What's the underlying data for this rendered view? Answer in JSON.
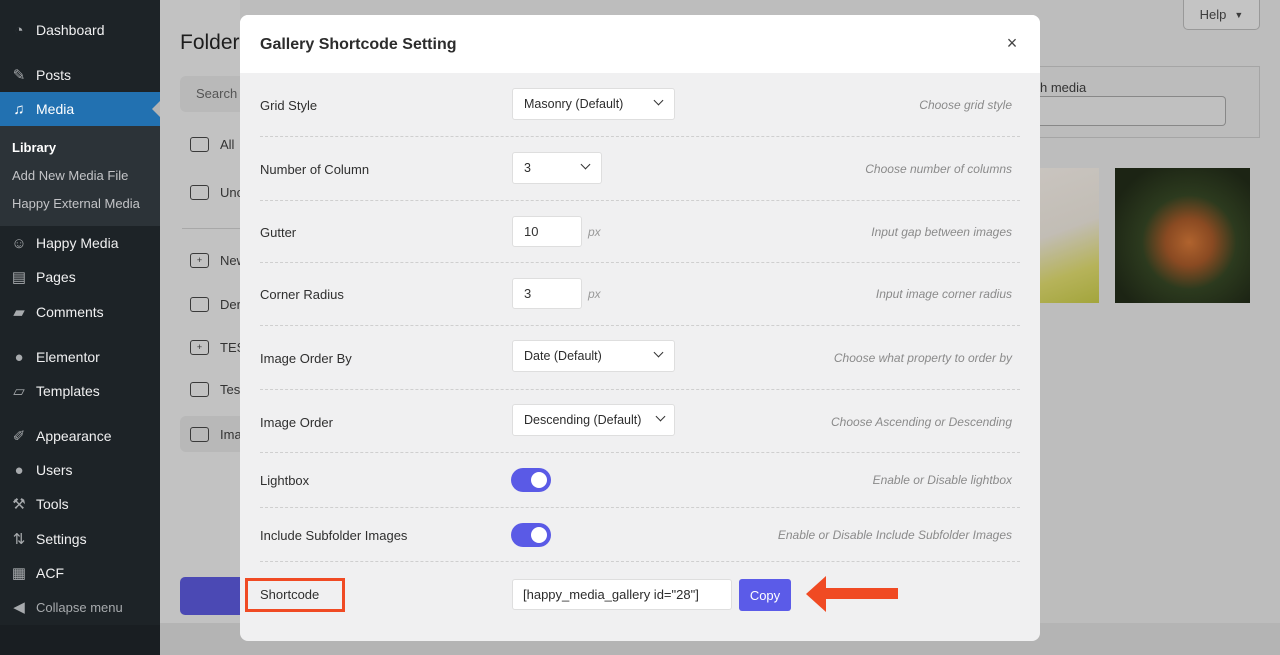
{
  "sidebar": {
    "items": [
      {
        "label": "Dashboard",
        "icon": "dashboard-icon"
      },
      {
        "label": "Posts",
        "icon": "pin-icon"
      },
      {
        "label": "Media",
        "icon": "media-icon",
        "active": true
      },
      {
        "label": "Happy Media",
        "icon": "happy-media-icon"
      },
      {
        "label": "Pages",
        "icon": "pages-icon"
      },
      {
        "label": "Comments",
        "icon": "comment-icon"
      },
      {
        "label": "Elementor",
        "icon": "elementor-icon"
      },
      {
        "label": "Templates",
        "icon": "folder-open-icon"
      },
      {
        "label": "Appearance",
        "icon": "brush-icon"
      },
      {
        "label": "Users",
        "icon": "user-icon"
      },
      {
        "label": "Tools",
        "icon": "wrench-icon"
      },
      {
        "label": "Settings",
        "icon": "sliders-icon"
      },
      {
        "label": "ACF",
        "icon": "table-icon"
      }
    ],
    "submenu": [
      {
        "label": "Library",
        "current": true
      },
      {
        "label": "Add New Media File"
      },
      {
        "label": "Happy External Media"
      }
    ],
    "collapse_label": "Collapse menu"
  },
  "background": {
    "folder_title": "Folder",
    "folder_search_placeholder": "Search",
    "folders": [
      "All",
      "Unc",
      "New",
      "Der",
      "TES",
      "Tes",
      "Ima"
    ],
    "help_label": "Help",
    "search_media_label": "h media"
  },
  "modal": {
    "title": "Gallery Shortcode Setting",
    "close_label": "×",
    "rows": [
      {
        "label": "Grid Style",
        "value": "Masonry (Default)",
        "desc": "Choose grid style"
      },
      {
        "label": "Number of Column",
        "value": "3",
        "desc": "Choose number of columns"
      },
      {
        "label": "Gutter",
        "value": "10",
        "unit": "px",
        "desc": "Input gap between images"
      },
      {
        "label": "Corner Radius",
        "value": "3",
        "unit": "px",
        "desc": "Input image corner radius"
      },
      {
        "label": "Image Order By",
        "value": "Date (Default)",
        "desc": "Choose what property to order by"
      },
      {
        "label": "Image Order",
        "value": "Descending (Default)",
        "desc": "Choose Ascending or Descending"
      },
      {
        "label": "Lightbox",
        "enabled": true,
        "desc": "Enable or Disable lightbox"
      },
      {
        "label": "Include Subfolder Images",
        "enabled": true,
        "desc": "Enable or Disable Include Subfolder Images"
      }
    ],
    "shortcode": {
      "label": "Shortcode",
      "value": "[happy_media_gallery id=\"28\"]",
      "copy_label": "Copy"
    }
  },
  "colors": {
    "accent": "#5b5be8",
    "highlight": "#f04a23",
    "wp_active": "#2271b1"
  }
}
